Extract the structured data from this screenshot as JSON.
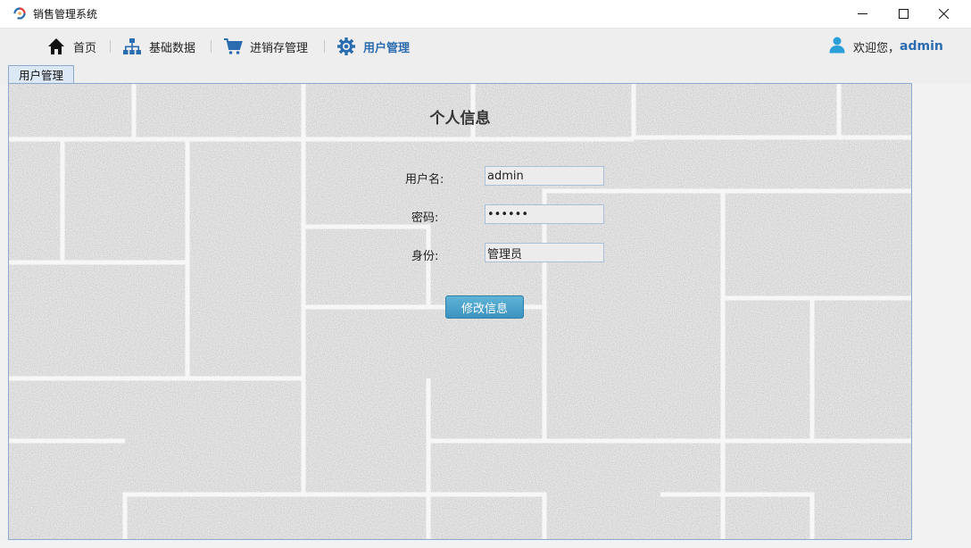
{
  "window": {
    "title": "销售管理系统",
    "icons": {
      "app": "app-logo-icon",
      "minimize": "minimize-icon",
      "maximize": "maximize-icon",
      "close": "close-icon"
    }
  },
  "menu": {
    "items": [
      {
        "label": "首页",
        "icon": "home-icon",
        "active": false
      },
      {
        "label": "基础数据",
        "icon": "org-chart-icon",
        "active": false
      },
      {
        "label": "进销存管理",
        "icon": "cart-icon",
        "active": false
      },
      {
        "label": "用户管理",
        "icon": "gear-icon",
        "active": true
      }
    ],
    "welcome_label": "欢迎您，",
    "welcome_user": "admin",
    "user_icon": "user-icon",
    "accent_color": "#2b6cb0"
  },
  "tabs": [
    {
      "label": "用户管理",
      "selected": true
    }
  ],
  "form": {
    "title": "个人信息",
    "username_label": "用户名:",
    "username_value": "admin",
    "password_label": "密码:",
    "password_value": "••••••",
    "role_label": "身份:",
    "role_value": "管理员",
    "submit_label": "修改信息",
    "button_color": "#3b93c0"
  }
}
